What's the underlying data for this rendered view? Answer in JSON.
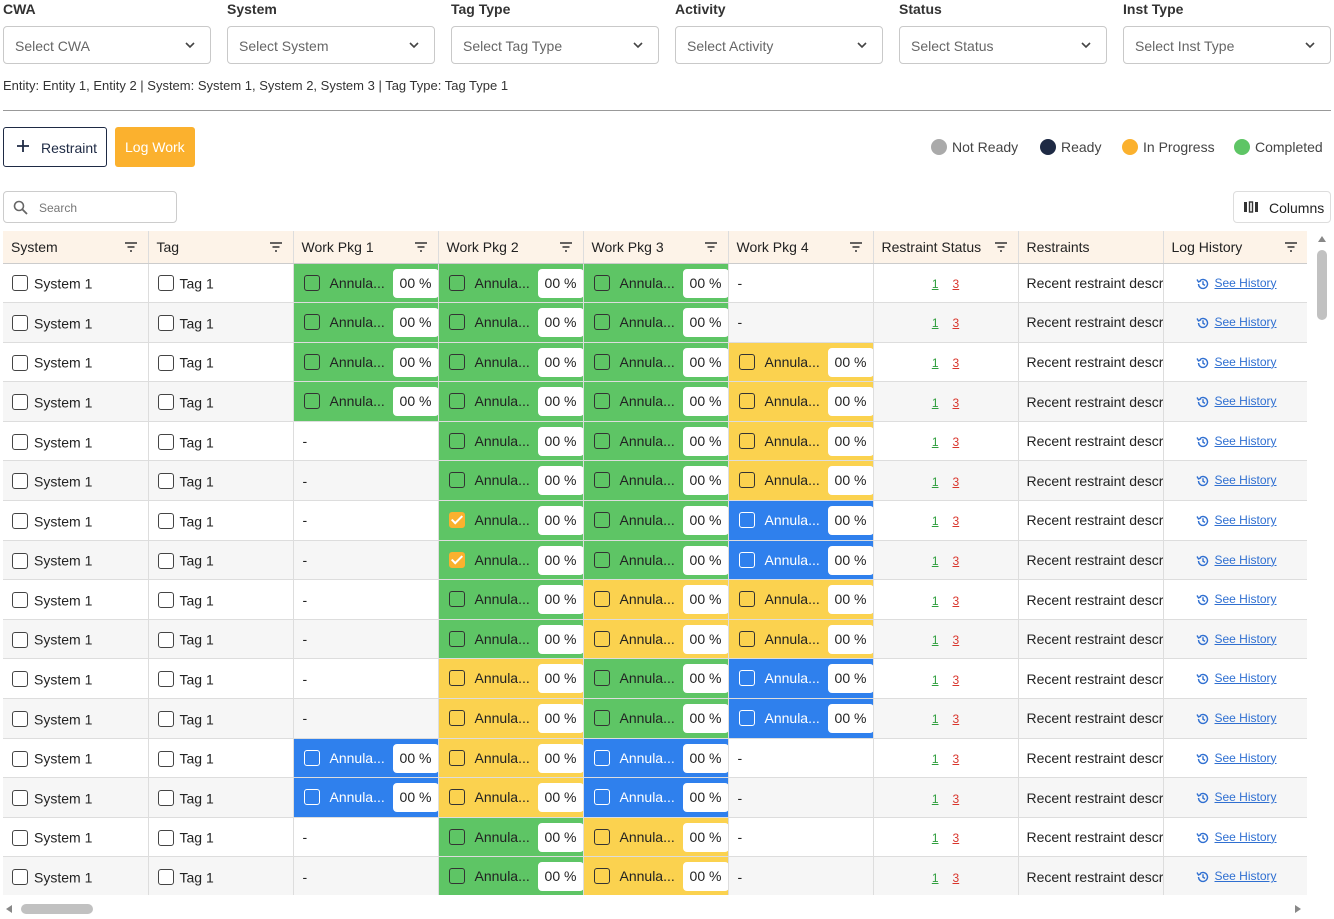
{
  "filters": [
    {
      "label": "CWA",
      "placeholder": "Select CWA"
    },
    {
      "label": "System",
      "placeholder": "Select System"
    },
    {
      "label": "Tag Type",
      "placeholder": "Select Tag Type"
    },
    {
      "label": "Activity",
      "placeholder": "Select Activity"
    },
    {
      "label": "Status",
      "placeholder": "Select Status"
    },
    {
      "label": "Inst Type",
      "placeholder": "Select Inst Type"
    }
  ],
  "summary": "Entity: Entity 1, Entity 2 | System: System 1, System 2, System 3 | Tag Type: Tag Type 1",
  "toolbar": {
    "restraint_label": "Restraint",
    "log_work_label": "Log Work"
  },
  "legend": [
    {
      "label": "Not Ready",
      "color": "#aaaaaa"
    },
    {
      "label": "Ready",
      "color": "#1e2a44"
    },
    {
      "label": "In Progress",
      "color": "#fbb12e"
    },
    {
      "label": "Completed",
      "color": "#5ec565"
    }
  ],
  "search": {
    "placeholder": "Search"
  },
  "columns_label": "Columns",
  "table": {
    "headers": [
      "System",
      "Tag",
      "Work Pkg 1",
      "Work Pkg 2",
      "Work Pkg 3",
      "Work Pkg 4",
      "Restraint Status",
      "Restraints",
      "Log History"
    ],
    "system_value": "System 1",
    "tag_value": "Tag 1",
    "wp_label": "Annula...",
    "wp_pct": "00 %",
    "empty": "-",
    "restraint_ok": "1",
    "restraint_open": "3",
    "restraint_text": "Recent restraint descri",
    "history_link": "See History",
    "rows": [
      [
        {
          "s": "green"
        },
        {
          "s": "green"
        },
        {
          "s": "green"
        },
        {
          "s": "none"
        }
      ],
      [
        {
          "s": "green"
        },
        {
          "s": "green"
        },
        {
          "s": "green"
        },
        {
          "s": "none"
        }
      ],
      [
        {
          "s": "green"
        },
        {
          "s": "green"
        },
        {
          "s": "green"
        },
        {
          "s": "yellow"
        }
      ],
      [
        {
          "s": "green"
        },
        {
          "s": "green"
        },
        {
          "s": "green"
        },
        {
          "s": "yellow"
        }
      ],
      [
        {
          "s": "none"
        },
        {
          "s": "green"
        },
        {
          "s": "green"
        },
        {
          "s": "yellow"
        }
      ],
      [
        {
          "s": "none"
        },
        {
          "s": "green"
        },
        {
          "s": "green"
        },
        {
          "s": "yellow"
        }
      ],
      [
        {
          "s": "none"
        },
        {
          "s": "green",
          "c": true
        },
        {
          "s": "green"
        },
        {
          "s": "blue"
        }
      ],
      [
        {
          "s": "none"
        },
        {
          "s": "green",
          "c": true
        },
        {
          "s": "green"
        },
        {
          "s": "blue"
        }
      ],
      [
        {
          "s": "none"
        },
        {
          "s": "green"
        },
        {
          "s": "yellow"
        },
        {
          "s": "yellow"
        }
      ],
      [
        {
          "s": "none"
        },
        {
          "s": "green"
        },
        {
          "s": "yellow"
        },
        {
          "s": "yellow"
        }
      ],
      [
        {
          "s": "none"
        },
        {
          "s": "yellow"
        },
        {
          "s": "green"
        },
        {
          "s": "blue"
        }
      ],
      [
        {
          "s": "none"
        },
        {
          "s": "yellow"
        },
        {
          "s": "green"
        },
        {
          "s": "blue"
        }
      ],
      [
        {
          "s": "blue"
        },
        {
          "s": "yellow"
        },
        {
          "s": "blue"
        },
        {
          "s": "none"
        }
      ],
      [
        {
          "s": "blue"
        },
        {
          "s": "yellow"
        },
        {
          "s": "blue"
        },
        {
          "s": "none"
        }
      ],
      [
        {
          "s": "none"
        },
        {
          "s": "green"
        },
        {
          "s": "yellow"
        },
        {
          "s": "none"
        }
      ],
      [
        {
          "s": "none"
        },
        {
          "s": "green"
        },
        {
          "s": "yellow"
        },
        {
          "s": "none"
        }
      ]
    ]
  }
}
